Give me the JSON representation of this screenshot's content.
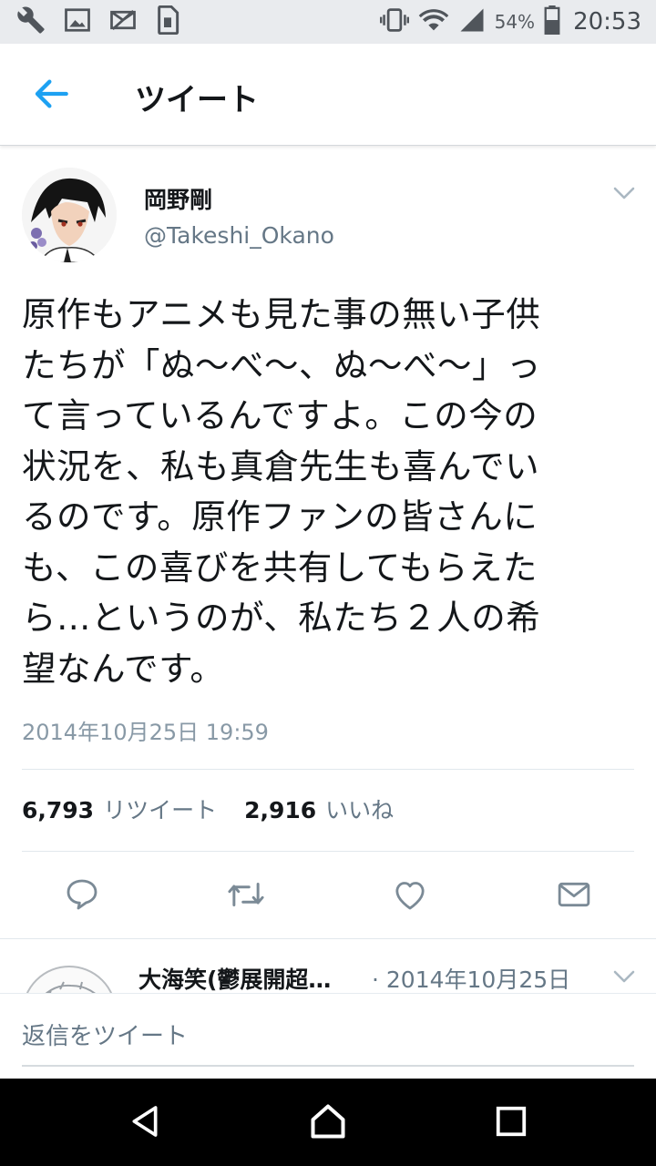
{
  "status_bar": {
    "icons_left": [
      "wrench-icon",
      "image-icon",
      "mail-off-icon",
      "sim-icon"
    ],
    "icons_right": [
      "vibrate-icon",
      "wifi-icon",
      "signal-icon",
      "battery-icon"
    ],
    "battery_percent": "54%",
    "time": "20:53"
  },
  "header": {
    "back_icon": "arrow-left-icon",
    "title": "ツイート"
  },
  "tweet": {
    "author_name": "岡野剛",
    "author_handle": "@Takeshi_Okano",
    "text": "原作もアニメも見た事の無い子供\nたちが「ぬ～べ～、ぬ～べ～」っ\nて言っているんですよ。この今の\n状況を、私も真倉先生も喜んでい\nるのです。原作ファンの皆さんに\nも、この喜びを共有してもらえた\nら…というのが、私たち２人の希\n望なんです。",
    "timestamp": "2014年10月25日 19:59",
    "retweet_count": "6,793",
    "retweet_label": "リツイート",
    "like_count": "2,916",
    "like_label": "いいね"
  },
  "actions": [
    "reply-icon",
    "retweet-icon",
    "like-icon",
    "message-icon"
  ],
  "reply_preview": {
    "author": "大海笑(鬱展開超…",
    "date": "· 2014年10月25日"
  },
  "composer": {
    "placeholder": "返信をツイート"
  },
  "nav_bar": {
    "buttons": [
      "back-triangle-icon",
      "home-circle-icon",
      "recents-square-icon"
    ]
  },
  "colors": {
    "accent": "#1da1f2",
    "text_primary": "#14171a",
    "text_secondary": "#657786",
    "status_bar_bg": "#e9ebee",
    "nav_bar_bg": "#000000"
  }
}
